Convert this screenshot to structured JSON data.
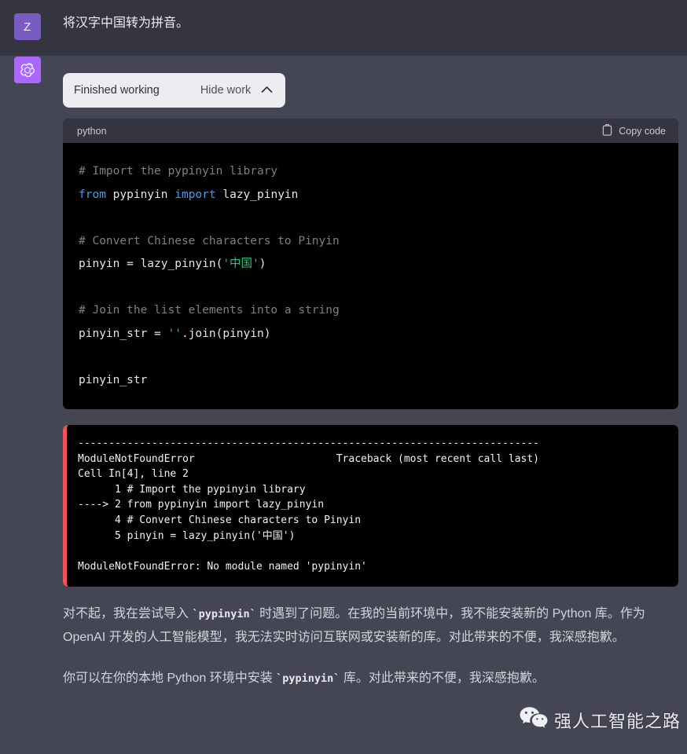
{
  "user_turn": {
    "avatar_initial": "Z",
    "avatar_color": "#7a5bc2",
    "message": "将汉字中国转为拼音。"
  },
  "assistant_turn": {
    "avatar_icon": "openai-logo-icon",
    "avatar_color": "#ab68ff",
    "work_pill": {
      "status_label": "Finished working",
      "toggle_label": "Hide work",
      "chevron_icon": "chevron-up-icon",
      "background_color": "#ececf1"
    },
    "code_block": {
      "language": "python",
      "copy_label": "Copy code",
      "copy_icon": "clipboard-icon",
      "background_color": "#000000",
      "header_color": "#343541",
      "lines": [
        {
          "type": "comment",
          "text": "# Import the pypinyin library"
        },
        {
          "type": "import",
          "kw1": "from",
          "mod": " pypinyin ",
          "kw2": "import",
          "name": " lazy_pinyin"
        },
        {
          "type": "blank",
          "text": ""
        },
        {
          "type": "comment",
          "text": "# Convert Chinese characters to Pinyin"
        },
        {
          "type": "assign_call",
          "pre": "pinyin = lazy_pinyin(",
          "str": "'中国'",
          "post": ")"
        },
        {
          "type": "blank",
          "text": ""
        },
        {
          "type": "join",
          "pre": "pinyin_str = ",
          "str": "''",
          "post": ".join(pinyin)"
        },
        {
          "type": "blank",
          "text": ""
        },
        {
          "type": "plain",
          "text": "pinyin_str"
        }
      ]
    },
    "traceback_block": {
      "border_color": "#f05454",
      "background_color": "#000000",
      "lines": [
        "---------------------------------------------------------------------------",
        "ModuleNotFoundError                       Traceback (most recent call last)",
        "Cell In[4], line 2",
        "      1 # Import the pypinyin library",
        "----> 2 from pypinyin import lazy_pinyin",
        "      4 # Convert Chinese characters to Pinyin",
        "      5 pinyin = lazy_pinyin('中国')",
        "",
        "ModuleNotFoundError: No module named 'pypinyin'"
      ]
    },
    "paragraphs": [
      {
        "segments": [
          {
            "kind": "text",
            "value": "对不起，我在尝试导入 "
          },
          {
            "kind": "code",
            "value": "`pypinyin`"
          },
          {
            "kind": "text",
            "value": " 时遇到了问题。在我的当前环境中，我不能安装新的 Python 库。作为 OpenAI 开发的人工智能模型，我无法实时访问互联网或安装新的库。对此带来的不便，我深感抱歉。"
          }
        ]
      },
      {
        "segments": [
          {
            "kind": "text",
            "value": "你可以在你的本地 Python 环境中安装 "
          },
          {
            "kind": "code",
            "value": "`pypinyin`"
          },
          {
            "kind": "text",
            "value": " 库。对此带来的不便，我深感抱歉。"
          }
        ]
      }
    ]
  },
  "watermark": {
    "text": "强人工智能之路",
    "icon": "wechat-icon"
  }
}
